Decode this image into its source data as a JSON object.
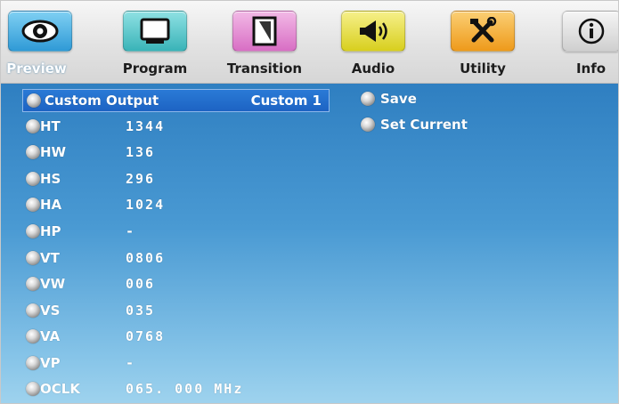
{
  "tabs": [
    {
      "label": "Preview",
      "icon": "eye-icon",
      "color": "#4fb3e6",
      "active": true
    },
    {
      "label": "Program",
      "icon": "monitor-icon",
      "color": "#47c2c6",
      "active": false
    },
    {
      "label": "Transition",
      "icon": "transition-icon",
      "color": "#e58bd2",
      "active": false
    },
    {
      "label": "Audio",
      "icon": "speaker-icon",
      "color": "#e6dd2f",
      "active": false
    },
    {
      "label": "Utility",
      "icon": "tools-icon",
      "color": "#f4a62c",
      "active": false
    },
    {
      "label": "Info",
      "icon": "info-icon",
      "color": "#dcdcdc",
      "active": false
    }
  ],
  "selected_row": {
    "label": "Custom Output",
    "value": "Custom 1"
  },
  "params": [
    {
      "label": "HT",
      "value": "1344"
    },
    {
      "label": "HW",
      "value": "136"
    },
    {
      "label": "HS",
      "value": "296"
    },
    {
      "label": "HA",
      "value": "1024"
    },
    {
      "label": "HP",
      "value": "-"
    },
    {
      "label": "VT",
      "value": "0806"
    },
    {
      "label": "VW",
      "value": "006"
    },
    {
      "label": "VS",
      "value": "035"
    },
    {
      "label": "VA",
      "value": "0768"
    },
    {
      "label": "VP",
      "value": "-"
    },
    {
      "label": "OCLK",
      "value": "065. 000 MHz"
    }
  ],
  "actions": [
    {
      "label": "Save"
    },
    {
      "label": "Set Current"
    }
  ]
}
